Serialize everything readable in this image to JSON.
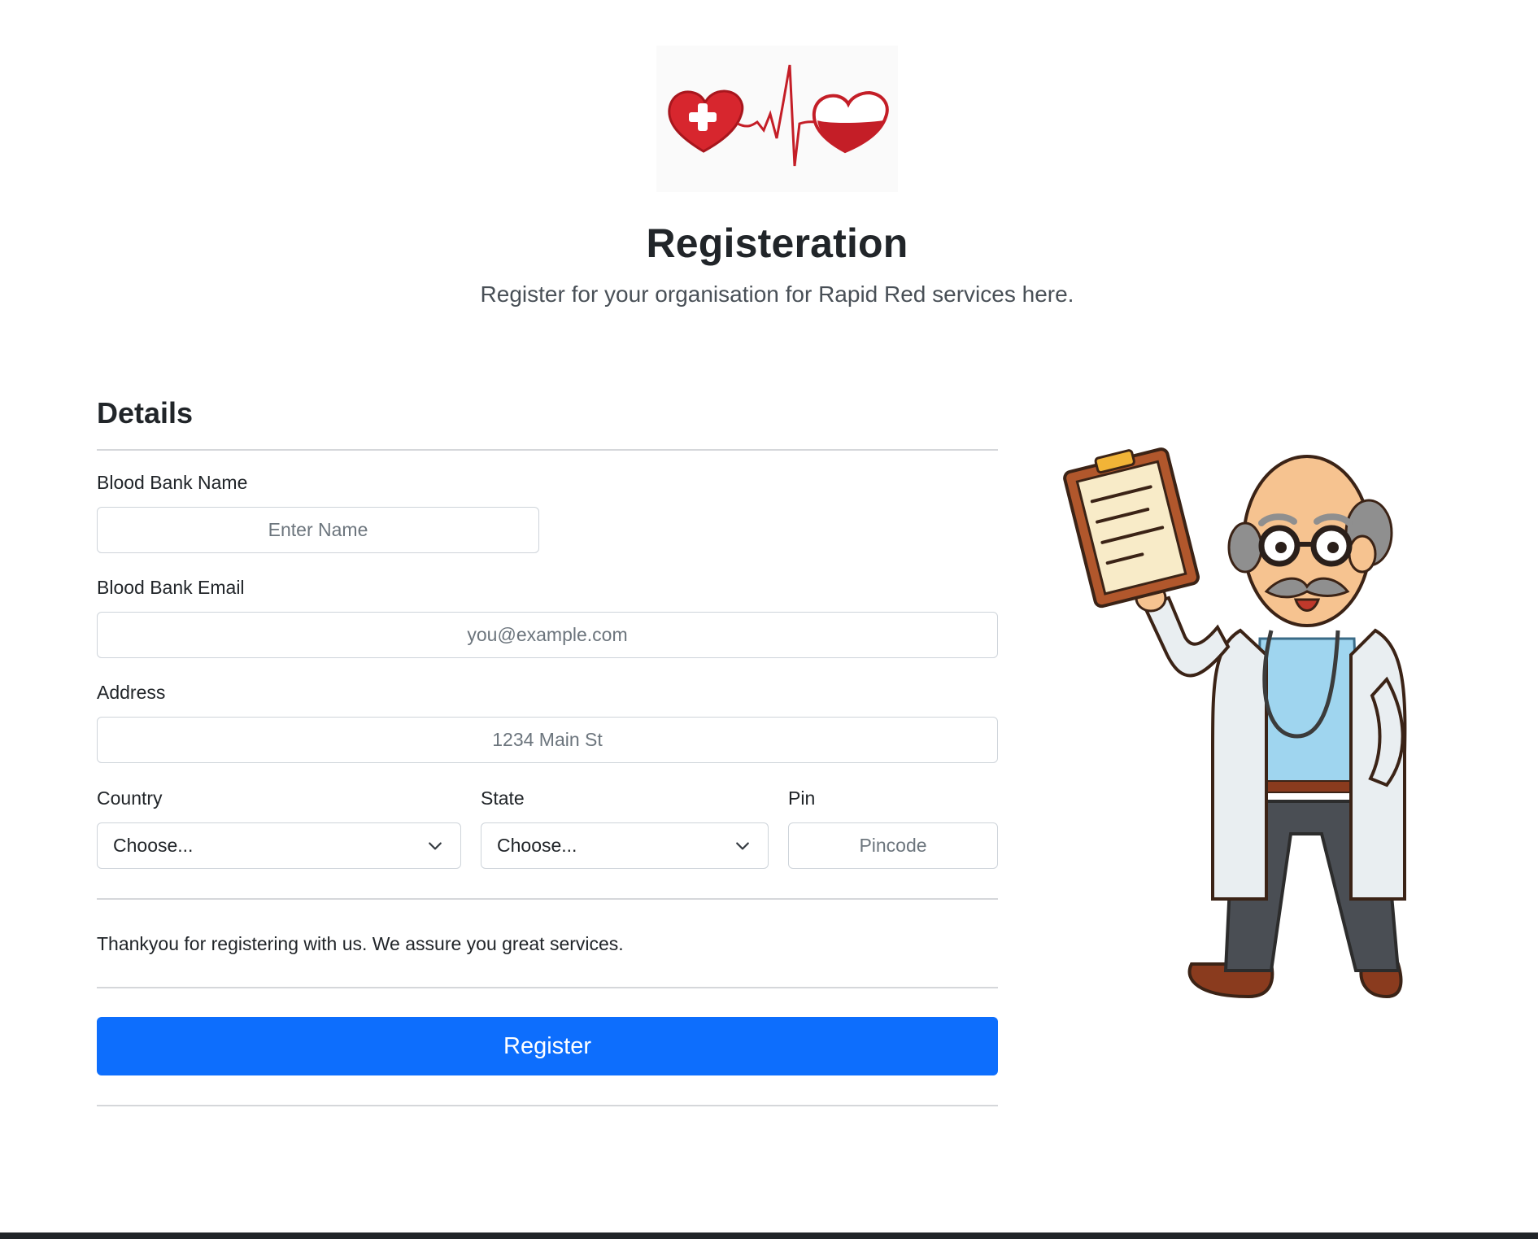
{
  "header": {
    "logo": "blood-bank-heartbeat-logo",
    "title": "Registeration",
    "subtitle": "Register for your organisation for Rapid Red services here."
  },
  "form": {
    "section_heading": "Details",
    "name": {
      "label": "Blood Bank Name",
      "placeholder": "Enter Name",
      "value": ""
    },
    "email": {
      "label": "Blood Bank Email",
      "placeholder": "you@example.com",
      "value": ""
    },
    "address": {
      "label": "Address",
      "placeholder": "1234 Main St",
      "value": ""
    },
    "country": {
      "label": "Country",
      "selected": "Choose..."
    },
    "state": {
      "label": "State",
      "selected": "Choose..."
    },
    "pin": {
      "label": "Pin",
      "placeholder": "Pincode",
      "value": ""
    },
    "note": "Thankyou for registering with us. We assure you great services.",
    "submit_label": "Register"
  },
  "illustration": "doctor-with-clipboard",
  "colors": {
    "primary": "#0d6efd",
    "brand_red": "#d7262e",
    "text": "#212529",
    "muted": "#6c757d",
    "border": "#ced4da"
  }
}
